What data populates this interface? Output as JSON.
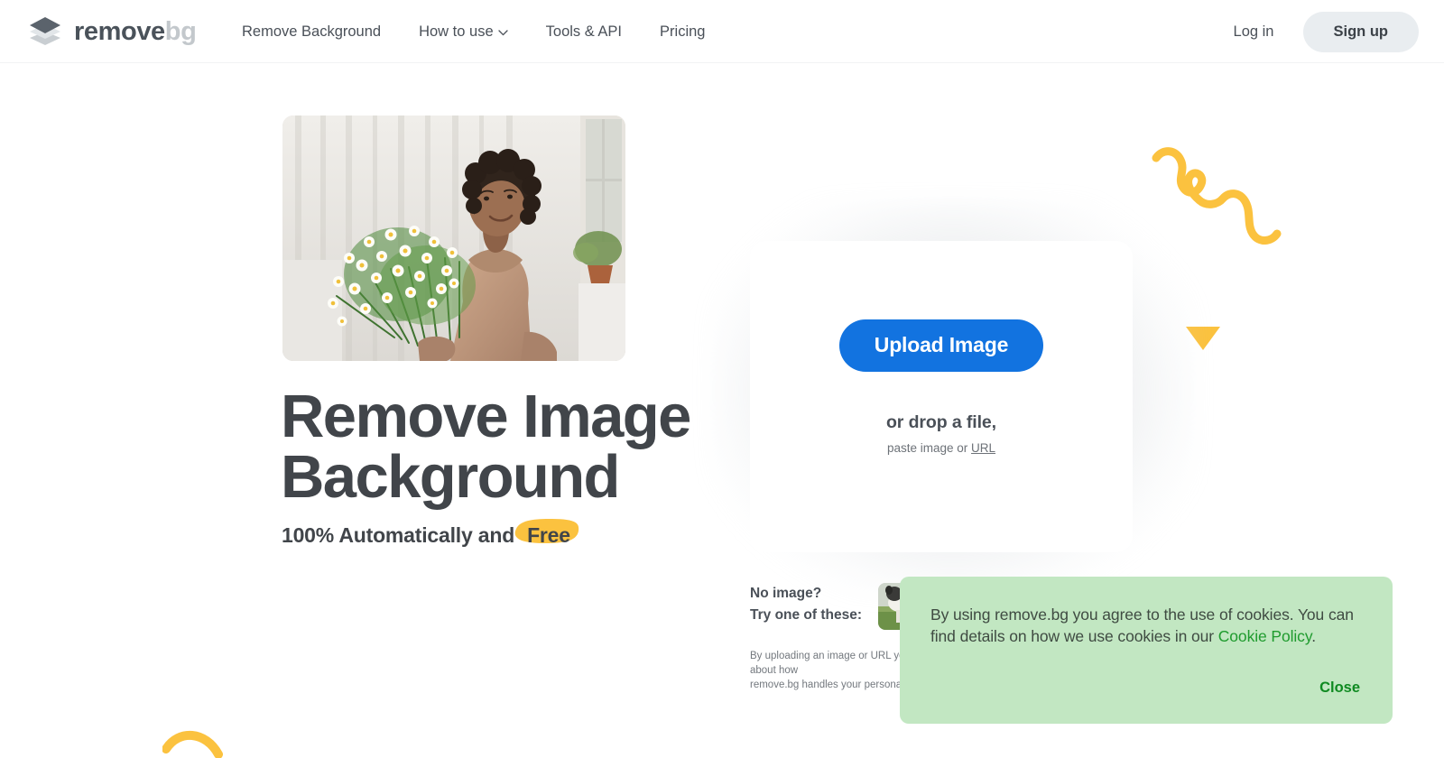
{
  "brand": {
    "word_primary": "remove",
    "word_secondary": "bg",
    "logo_icon": "stacked-diamond-logo-icon"
  },
  "nav": {
    "links": [
      {
        "label": "Remove Background",
        "has_caret": false
      },
      {
        "label": "How to use",
        "has_caret": true,
        "caret_icon": "chevron-down-icon"
      },
      {
        "label": "Tools & API",
        "has_caret": false
      },
      {
        "label": "Pricing",
        "has_caret": false
      }
    ],
    "login_label": "Log in",
    "signup_label": "Sign up"
  },
  "hero": {
    "title_line1": "Remove Image",
    "title_line2": "Background",
    "subtitle_prefix": "100% Automatically and",
    "subtitle_highlight": "Free",
    "photo_alt": "woman holding a bouquet of white daisies"
  },
  "upload": {
    "button_label": "Upload Image",
    "drop_text": "or drop a file,",
    "paste_prefix": "paste image or",
    "paste_link": "URL"
  },
  "samples": {
    "label_line1": "No image?",
    "label_line2": "Try one of these:",
    "thumbnails": [
      {
        "name": "sample-dog-on-grass"
      }
    ]
  },
  "fineprint": {
    "line1": "By uploading an image or URL you agree to our Terms of Service. To learn more about how",
    "line2": "remove.bg handles your personal data, check our Privacy Policy."
  },
  "cookie": {
    "text_before_link": "By using remove.bg you agree to the use of cookies. You can find details on how we use cookies in our ",
    "link_label": "Cookie Policy",
    "text_after_link": ".",
    "close_label": "Close"
  },
  "decorations": [
    {
      "name": "yellow-squiggle-decoration"
    },
    {
      "name": "yellow-triangle-decoration"
    },
    {
      "name": "yellow-arc-decoration"
    }
  ],
  "colors": {
    "accent_blue": "#1273e0",
    "brand_dark": "#4a525a",
    "brand_light": "#c3c8cc",
    "highlight_yellow": "#fbc23f",
    "cookie_green_bg": "#c2e7c2",
    "cookie_green_link": "#1f9b2e",
    "signup_bg": "#e9edf0",
    "text_dark": "#41454a"
  }
}
